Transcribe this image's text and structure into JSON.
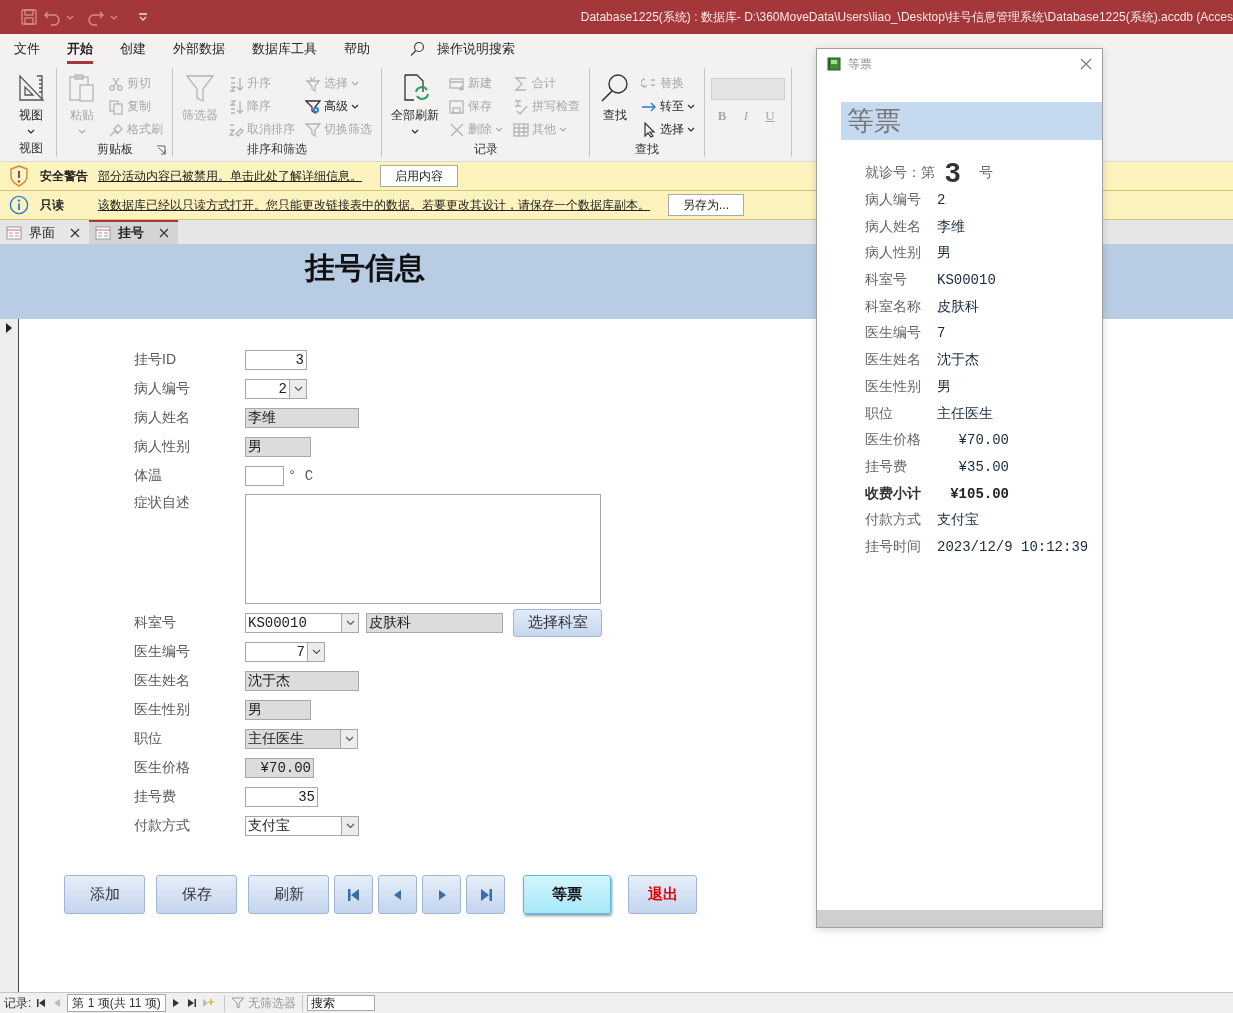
{
  "window": {
    "title": "Database1225(系统) : 数据库- D:\\360MoveData\\Users\\liao_\\Desktop\\挂号信息管理系统\\Database1225(系统).accdb (Acces"
  },
  "menu": {
    "tabs": [
      {
        "label": "文件",
        "selected": false
      },
      {
        "label": "开始",
        "selected": true
      },
      {
        "label": "创建",
        "selected": false
      },
      {
        "label": "外部数据",
        "selected": false
      },
      {
        "label": "数据库工具",
        "selected": false
      },
      {
        "label": "帮助",
        "selected": false
      }
    ],
    "tell_me": "操作说明搜索"
  },
  "ribbon": {
    "groups": [
      {
        "kind": "standard",
        "label": "视图",
        "dialog_launcher": false,
        "columns": [
          [
            {
              "label": "视图",
              "kind": "large",
              "disabled": false,
              "dropdown": true
            }
          ]
        ]
      },
      {
        "kind": "standard",
        "label": "剪贴板",
        "dialog_launcher": true,
        "columns": [
          [
            {
              "label": "粘贴",
              "kind": "large",
              "disabled": true,
              "dropdown": true
            }
          ],
          [
            {
              "label": "剪切",
              "kind": "small",
              "disabled": true,
              "dropdown": false
            },
            {
              "label": "复制",
              "kind": "small",
              "disabled": true,
              "dropdown": false
            },
            {
              "label": "格式刷",
              "kind": "small",
              "disabled": true,
              "dropdown": false
            }
          ]
        ]
      },
      {
        "kind": "standard",
        "label": "排序和筛选",
        "dialog_launcher": false,
        "columns": [
          [
            {
              "label": "筛选器",
              "kind": "large",
              "disabled": true,
              "dropdown": false
            }
          ],
          [
            {
              "label": "升序",
              "kind": "small",
              "disabled": true,
              "dropdown": false
            },
            {
              "label": "降序",
              "kind": "small",
              "disabled": true,
              "dropdown": false
            },
            {
              "label": "取消排序",
              "kind": "small",
              "disabled": true,
              "dropdown": false
            }
          ],
          [
            {
              "label": "选择",
              "kind": "small",
              "disabled": true,
              "dropdown": true
            },
            {
              "label": "高级",
              "kind": "small",
              "disabled": false,
              "dropdown": true
            },
            {
              "label": "切换筛选",
              "kind": "small",
              "disabled": true,
              "dropdown": false
            }
          ]
        ]
      },
      {
        "kind": "standard",
        "label": "记录",
        "dialog_launcher": false,
        "columns": [
          [
            {
              "label": "全部刷新",
              "kind": "large",
              "disabled": false,
              "dropdown": true
            }
          ],
          [
            {
              "label": "新建",
              "kind": "small",
              "disabled": true,
              "dropdown": false
            },
            {
              "label": "保存",
              "kind": "small",
              "disabled": true,
              "dropdown": false
            },
            {
              "label": "删除",
              "kind": "small",
              "disabled": true,
              "dropdown": true
            }
          ],
          [
            {
              "label": "合计",
              "kind": "small",
              "disabled": true,
              "dropdown": false
            },
            {
              "label": "拼写检查",
              "kind": "small",
              "disabled": true,
              "dropdown": false
            },
            {
              "label": "其他",
              "kind": "small",
              "disabled": true,
              "dropdown": true
            }
          ]
        ]
      },
      {
        "kind": "standard",
        "label": "查找",
        "dialog_launcher": false,
        "columns": [
          [
            {
              "label": "查找",
              "kind": "large",
              "disabled": false,
              "dropdown": false
            }
          ],
          [
            {
              "label": "替换",
              "kind": "small",
              "disabled": true,
              "dropdown": false
            },
            {
              "label": "转至",
              "kind": "small",
              "disabled": false,
              "dropdown": true
            },
            {
              "label": "选择",
              "kind": "small",
              "disabled": false,
              "dropdown": true
            }
          ]
        ]
      },
      {
        "kind": "font",
        "letters": [
          {
            "label": "B",
            "disabled": true
          },
          {
            "label": "I",
            "disabled": true
          },
          {
            "label": "U",
            "disabled": true
          }
        ]
      }
    ]
  },
  "message_bars": [
    {
      "kind": "warning",
      "title": "安全警告",
      "message": "部分活动内容已被禁用。单击此处了解详细信息。",
      "button": "启用内容"
    },
    {
      "kind": "info",
      "title": "只读",
      "message": "该数据库已经以只读方式打开。您只能更改链接表中的数据。若要更改其设计，请保存一个数据库副本。",
      "button": "另存为..."
    }
  ],
  "document_tabs": [
    {
      "label": "界面",
      "selected": false
    },
    {
      "label": "挂号",
      "selected": true
    }
  ],
  "form": {
    "title": "挂号信息",
    "fields": [
      {
        "label": "挂号ID",
        "kind": "number",
        "value": "3",
        "locked": false
      },
      {
        "label": "病人编号",
        "kind": "numcombo",
        "value": "2",
        "locked": false
      },
      {
        "label": "病人姓名",
        "kind": "text",
        "value": "李维",
        "locked": true
      },
      {
        "label": "病人性别",
        "kind": "text",
        "value": "男",
        "locked": true
      },
      {
        "label": "体温",
        "kind": "text",
        "locked": false,
        "suffix": "° C"
      },
      {
        "label": "症状自述",
        "kind": "memo",
        "locked": false
      },
      {
        "label": "科室号",
        "kind": "combo",
        "value": "KS00010",
        "locked": false,
        "extras": [
          {
            "kind": "text",
            "value": "皮肤科",
            "locked": true
          },
          {
            "kind": "button",
            "label": "选择科室"
          }
        ]
      },
      {
        "label": "医生编号",
        "kind": "numcombo",
        "value": "7",
        "locked": false
      },
      {
        "label": "医生姓名",
        "kind": "text",
        "value": "沈于杰",
        "locked": true
      },
      {
        "label": "医生性别",
        "kind": "text",
        "value": "男",
        "locked": true
      },
      {
        "label": "职位",
        "kind": "combo",
        "value": "主任医生",
        "locked": true
      },
      {
        "label": "医生价格",
        "kind": "number",
        "value": "¥70.00",
        "locked": true
      },
      {
        "label": "挂号费",
        "kind": "number",
        "value": "35",
        "locked": false
      },
      {
        "label": "付款方式",
        "kind": "combo",
        "value": "支付宝",
        "locked": false
      }
    ],
    "buttons": [
      {
        "kind": "text",
        "label": "添加"
      },
      {
        "kind": "text",
        "label": "保存"
      },
      {
        "kind": "text",
        "label": "刷新"
      },
      {
        "kind": "first"
      },
      {
        "kind": "previous"
      },
      {
        "kind": "next"
      },
      {
        "kind": "last"
      },
      {
        "kind": "highlight",
        "label": "等票"
      },
      {
        "kind": "exit",
        "label": "退出"
      }
    ]
  },
  "ticket_window": {
    "title": "等票",
    "heading": "等票",
    "number_label": "就诊号：第",
    "number": "3",
    "number_suffix": "号",
    "rows": [
      {
        "label": "病人编号",
        "value": "2",
        "kind": "text",
        "bold": false
      },
      {
        "label": "病人姓名",
        "value": "李维",
        "kind": "text",
        "bold": false
      },
      {
        "label": "病人性别",
        "value": "男",
        "kind": "text",
        "bold": false
      },
      {
        "label": "科室号",
        "value": "KS00010",
        "kind": "text",
        "bold": false
      },
      {
        "label": "科室名称",
        "value": "皮肤科",
        "kind": "text",
        "bold": false
      },
      {
        "label": "医生编号",
        "value": "7",
        "kind": "text",
        "bold": false
      },
      {
        "label": "医生姓名",
        "value": "沈于杰",
        "kind": "text",
        "bold": false
      },
      {
        "label": "医生性别",
        "value": "男",
        "kind": "text",
        "bold": false
      },
      {
        "label": "职位",
        "value": "主任医生",
        "kind": "text",
        "bold": false
      },
      {
        "label": "医生价格",
        "value": "¥70.00",
        "kind": "amount",
        "bold": false
      },
      {
        "label": "挂号费",
        "value": "¥35.00",
        "kind": "amount",
        "bold": false
      },
      {
        "label": "收费小计",
        "value": "¥105.00",
        "kind": "amount",
        "bold": true
      },
      {
        "label": "付款方式",
        "value": "支付宝",
        "kind": "text",
        "bold": false
      },
      {
        "label": "挂号时间",
        "value": "2023/12/9 10:12:39",
        "kind": "text",
        "bold": false
      }
    ]
  },
  "record_navigator": {
    "label": "记录:",
    "position": "第 1 项(共 11 项)",
    "filter": "无筛选器",
    "search_placeholder": "搜索"
  }
}
